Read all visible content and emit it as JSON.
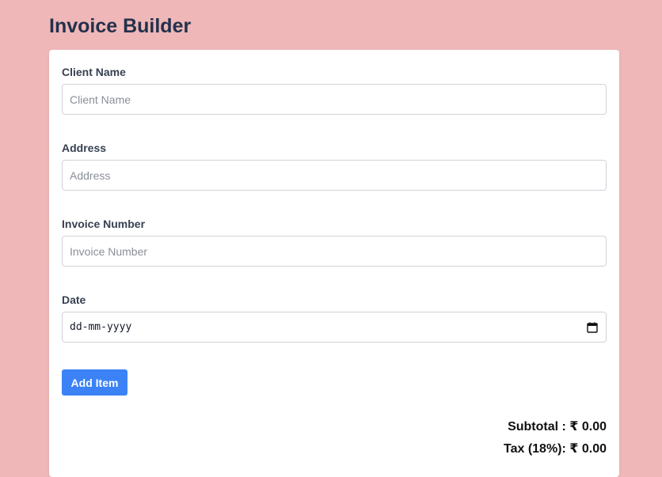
{
  "page": {
    "title": "Invoice Builder"
  },
  "form": {
    "client_name": {
      "label": "Client Name",
      "placeholder": "Client Name",
      "value": ""
    },
    "address": {
      "label": "Address",
      "placeholder": "Address",
      "value": ""
    },
    "invoice_number": {
      "label": "Invoice Number",
      "placeholder": "Invoice Number",
      "value": ""
    },
    "date": {
      "label": "Date",
      "placeholder": "dd-mm-yyyy",
      "icon": "calendar-icon"
    },
    "add_item_label": "Add Item"
  },
  "totals": {
    "subtotal": "Subtotal : ₹ 0.00",
    "tax": "Tax (18%): ₹ 0.00"
  },
  "colors": {
    "background": "#efb7b8",
    "card": "#ffffff",
    "title": "#23314b",
    "primary_button": "#3b82f6"
  }
}
